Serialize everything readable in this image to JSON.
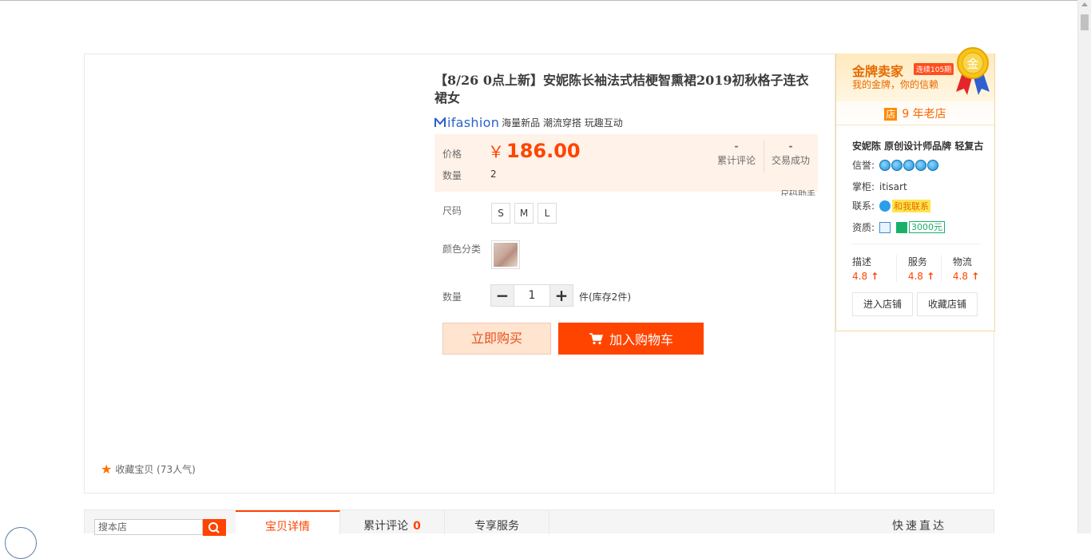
{
  "product": {
    "title": "【8/26 0点上新】安妮陈长袖法式桔梗智熏裙2019初秋格子连衣裙女",
    "brand_logo": "ifashion",
    "brand_slogan": "海量新品 潮流穿搭 玩趣互动",
    "price_label": "价格",
    "currency": "￥",
    "price": "186.00",
    "qty_label": "数量",
    "qty_value": "2",
    "reviews_value": "-",
    "reviews_label": "累计评论",
    "sales_value": "-",
    "sales_label": "交易成功",
    "size_helper": "尺码助手",
    "size_label": "尺码",
    "sizes": [
      "S",
      "M",
      "L"
    ],
    "color_label": "颜色分类",
    "quantity_label": "数量",
    "quantity": "1",
    "stock_text": "件(库存2件)",
    "buy_now": "立即购买",
    "add_cart": "加入购物车",
    "favorite": "收藏宝贝 (73人气)"
  },
  "shop": {
    "gold_title": "金牌卖家",
    "gold_badge": "连续105期",
    "gold_slogan": "我的金牌，你的信赖",
    "medal_char": "金",
    "old_shop": "9 年老店",
    "shop_icon": "店",
    "name": "安妮陈 原创设计师品牌 轻复古",
    "credit_label": "信誉:",
    "keeper_label": "掌柜:",
    "keeper": "itisart",
    "contact_label": "联系:",
    "contact_text": "和我联系",
    "qualify_label": "资质:",
    "deposit": "3000元",
    "scores": [
      {
        "label": "描述",
        "value": "4.8"
      },
      {
        "label": "服务",
        "value": "4.8"
      },
      {
        "label": "物流",
        "value": "4.8"
      }
    ],
    "enter_shop": "进入店铺",
    "fav_shop": "收藏店铺"
  },
  "bottom": {
    "search_placeholder": "搜本店",
    "tabs": [
      {
        "label": "宝贝详情"
      },
      {
        "label": "累计评论",
        "count": "0"
      },
      {
        "label": "专享服务"
      }
    ],
    "quick": "快速直达"
  },
  "colors": {
    "accent": "#ff4400",
    "gold": "#e56a00"
  }
}
